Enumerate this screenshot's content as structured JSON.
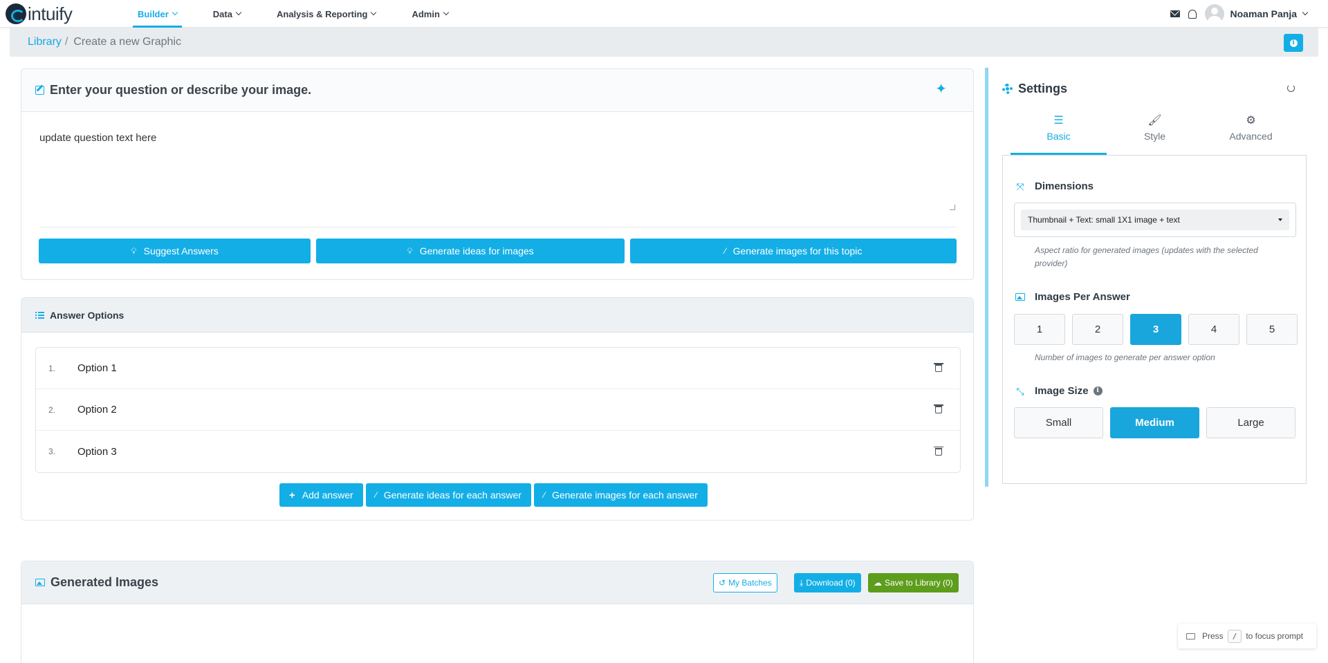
{
  "app": {
    "logo_text": "intuify"
  },
  "topnav": {
    "items": [
      {
        "label": "Builder",
        "active": true
      },
      {
        "label": "Data",
        "active": false
      },
      {
        "label": "Analysis & Reporting",
        "active": false
      },
      {
        "label": "Admin",
        "active": false
      }
    ],
    "user_name": "Noaman Panja",
    "icons": [
      "envelope-icon",
      "bell-icon",
      "avatar"
    ]
  },
  "breadcrumb": {
    "library": "Library",
    "separator": "/",
    "current": "Create a new Graphic",
    "info_icon": "i"
  },
  "question": {
    "title": "Enter your question or describe your image.",
    "value": "update question text here",
    "buttons": {
      "suggest": "Suggest Answers",
      "ideas": "Generate ideas for images",
      "images": "Generate images for this topic"
    }
  },
  "answers": {
    "title": "Answer Options",
    "items": [
      {
        "num": "1.",
        "label": "Option 1"
      },
      {
        "num": "2.",
        "label": "Option 2"
      },
      {
        "num": "3.",
        "label": "Option 3"
      }
    ],
    "buttons": {
      "add": "Add answer",
      "ideas_each": "Generate ideas for each answer",
      "images_each": "Generate images for each answer"
    }
  },
  "generated": {
    "title": "Generated Images",
    "my_batches": "My Batches",
    "download": "Download (0)",
    "save": "Save to Library (0)"
  },
  "settings": {
    "title": "Settings",
    "tabs": [
      {
        "label": "Basic",
        "active": true
      },
      {
        "label": "Style",
        "active": false
      },
      {
        "label": "Advanced",
        "active": false
      }
    ],
    "dimensions": {
      "label": "Dimensions",
      "selected": "Thumbnail + Text: small 1X1 image + text",
      "help": "Aspect ratio for generated images (updates with the selected provider)"
    },
    "images_per_answer": {
      "label": "Images Per Answer",
      "options": [
        "1",
        "2",
        "3",
        "4",
        "5"
      ],
      "selected": "3",
      "help": "Number of images to generate per answer option"
    },
    "image_size": {
      "label": "Image Size",
      "info": "i",
      "options": [
        "Small",
        "Medium",
        "Large"
      ],
      "selected": "Medium"
    }
  },
  "hint": {
    "press": "Press",
    "key": "/",
    "suffix": "to focus prompt"
  },
  "colors": {
    "accent": "#13aee6",
    "save_green": "#5d9d1c",
    "active_seg": "#19a6dc"
  }
}
